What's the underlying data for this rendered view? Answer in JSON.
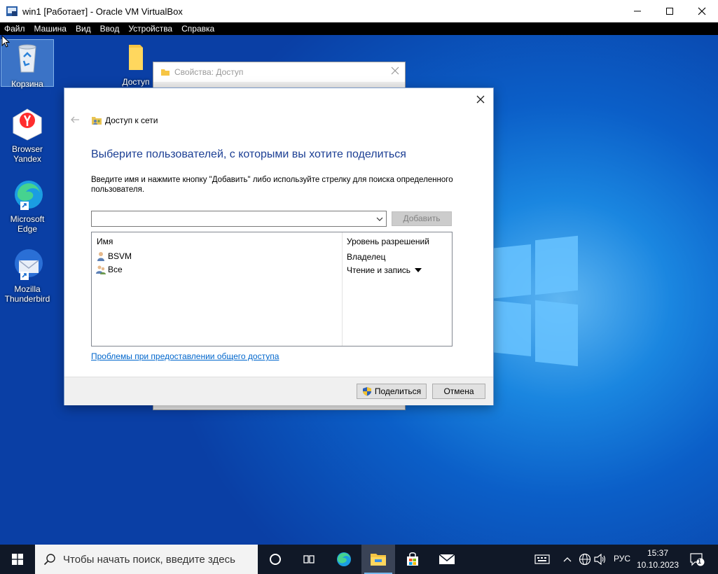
{
  "vbox": {
    "title": "win1 [Работает] - Oracle VM VirtualBox",
    "menu": [
      "Файл",
      "Машина",
      "Вид",
      "Ввод",
      "Устройства",
      "Справка"
    ]
  },
  "desktop": {
    "icons": [
      {
        "label": "Корзина"
      },
      {
        "label": "Доступ"
      },
      {
        "label": "Browser Yandex"
      },
      {
        "label": "Microsoft Edge"
      },
      {
        "label": "Mozilla Thunderbird"
      }
    ]
  },
  "props_window": {
    "title": "Свойства: Доступ"
  },
  "dialog": {
    "header_title": "Доступ к сети",
    "heading": "Выберите пользователей, с которыми вы хотите поделиться",
    "instructions": "Введите имя и нажмите кнопку \"Добавить\" либо используйте стрелку для поиска определенного пользователя.",
    "user_input_value": "",
    "add_button": "Добавить",
    "columns": {
      "name": "Имя",
      "permission": "Уровень разрешений"
    },
    "rows": [
      {
        "name": "BSVM",
        "permission": "Владелец",
        "icon": "user-icon"
      },
      {
        "name": "Все",
        "permission": "Чтение и запись",
        "icon": "group-icon"
      }
    ],
    "help_link": "Проблемы при предоставлении общего доступа",
    "share_button": "Поделиться",
    "cancel_button": "Отмена"
  },
  "taskbar": {
    "search_placeholder": "Чтобы начать поиск, введите здесь",
    "lang": "РУС",
    "time": "15:37",
    "date": "10.10.2023",
    "notification_count": "1"
  },
  "colors": {
    "dialog_heading": "#1c3f94",
    "link": "#0066cc",
    "taskbar": "#101827"
  }
}
